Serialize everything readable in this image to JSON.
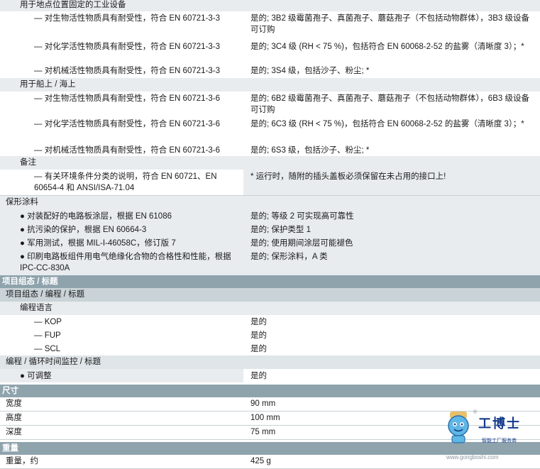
{
  "env": {
    "fixed_header": "用于地点位置固定的工业设备",
    "fixed_rows": [
      {
        "label": "— 对生物活性物质具有耐受性，符合 EN 60721-3-3",
        "value": "是的; 3B2 级霉菌孢子、真菌孢子、蘑菇孢子（不包括动物群体），3B3 级设备可订购"
      },
      {
        "label": "— 对化学活性物质具有耐受性，符合 EN 60721-3-3",
        "value": "是的; 3C4 级 (RH < 75 %)，包括符合 EN 60068-2-52 的盐雾（清晰度 3）；*"
      },
      {
        "label": "— 对机械活性物质具有耐受性，符合 EN 60721-3-3",
        "value": "是的; 3S4 级，包括沙子、粉尘; *"
      }
    ],
    "ship_header": "用于船上 / 海上",
    "ship_rows": [
      {
        "label": "— 对生物活性物质具有耐受性，符合 EN 60721-3-6",
        "value": "是的; 6B2 级霉菌孢子、真菌孢子、蘑菇孢子（不包括动物群体），6B3 级设备可订购"
      },
      {
        "label": "— 对化学活性物质具有耐受性，符合 EN 60721-3-6",
        "value": "是的; 6C3 级 (RH < 75 %)，包括符合 EN 60068-2-52 的盐雾（清晰度 3）；*"
      },
      {
        "label": "— 对机械活性物质具有耐受性，符合 EN 60721-3-6",
        "value": "是的; 6S3 级，包括沙子、粉尘; *"
      }
    ],
    "remark_header": "备注",
    "remark_label": "— 有关环境条件分类的说明，符合 EN 60721、EN 60654-4 和 ANSI/ISA-71.04",
    "remark_value": "* 运行时，随附的插头盖板必须保留在未占用的接口上!"
  },
  "coating": {
    "header": "保形涂料",
    "rows": [
      {
        "label": "● 对装配好的电路板涂层，根据 EN 61086",
        "value": "是的; 等级 2 可实现高可靠性"
      },
      {
        "label": "● 抗污染的保护，根据 EN 60664-3",
        "value": "是的; 保护类型 1"
      },
      {
        "label": "● 军用测试，根据 MIL-I-46058C，修订版 7",
        "value": "是的; 使用期间涂层可能褪色"
      },
      {
        "label": "● 印刷电路板组件用电气绝缘化合物的合格性和性能，根据 IPC-CC-830A",
        "value": "是的; 保形涂料，A 类"
      }
    ]
  },
  "project": {
    "section": "项目组态 / 标题",
    "subsection": "项目组态 / 编程 / 标题",
    "lang_header": "编程语言",
    "langs": [
      {
        "label": "— KOP",
        "value": "是的"
      },
      {
        "label": "— FUP",
        "value": "是的"
      },
      {
        "label": "— SCL",
        "value": "是的"
      }
    ],
    "cycle_header": "编程 / 循环时间监控 / 标题",
    "cycle_row": {
      "label": "● 可调整",
      "value": "是的"
    }
  },
  "dimensions": {
    "section": "尺寸",
    "rows": [
      {
        "label": "宽度",
        "value": "90 mm"
      },
      {
        "label": "高度",
        "value": "100 mm"
      },
      {
        "label": "深度",
        "value": "75 mm"
      }
    ]
  },
  "weight": {
    "section": "重量",
    "row": {
      "label": "重量，约",
      "value": "425 g"
    }
  },
  "logo": {
    "text": "工博士",
    "reg": "®",
    "subtitle": "智能工厂服务商",
    "watermark": "www.gongboshi.com"
  }
}
